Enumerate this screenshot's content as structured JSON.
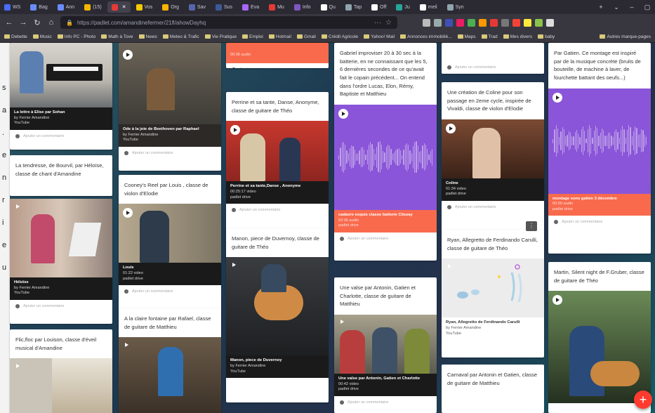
{
  "browser": {
    "tabs": [
      {
        "label": "WS",
        "color": "#4a6cf7"
      },
      {
        "label": "Bag",
        "color": "#6a8cff"
      },
      {
        "label": "Ann",
        "color": "#6a8cff"
      },
      {
        "label": "(15)",
        "color": "#f7b500"
      },
      {
        "label": "",
        "color": "#e53935",
        "active": true
      },
      {
        "label": "Vos",
        "color": "#f7c900"
      },
      {
        "label": "Org",
        "color": "#ffb300"
      },
      {
        "label": "Sav",
        "color": "#5566aa"
      },
      {
        "label": "Sus",
        "color": "#3b5998"
      },
      {
        "label": "Eva",
        "color": "#aa66ff"
      },
      {
        "label": "Mu",
        "color": "#e53935"
      },
      {
        "label": "Info",
        "color": "#7e57c2"
      },
      {
        "label": "Qu",
        "color": "#ffffff"
      },
      {
        "label": "Tap",
        "color": "#90a4ae"
      },
      {
        "label": "Off",
        "color": "#ffffff"
      },
      {
        "label": "Ju",
        "color": "#26a69a"
      },
      {
        "label": "meil",
        "color": "#ffffff"
      },
      {
        "label": "Syn",
        "color": "#90a4ae"
      }
    ],
    "url": "https://padlet.com/amandinefermer/21fl/ahowDayhq",
    "bookmarks": [
      "Debette",
      "Music",
      "Info PC - Photo",
      "Math à Tove",
      "News",
      "Meteo & Trafic",
      "Vie Pratique",
      "Emploi",
      "Hotmail",
      "Gmail",
      "Crédit Agricole",
      "Yahoo! Mail",
      "Annonces immobiliè...",
      "Maps",
      "Trad",
      "Mes divers",
      "baby",
      "Autres marque-pages"
    ]
  },
  "left_strip": [
    "s",
    "a",
    ".",
    "e",
    "n",
    "r",
    "i",
    "e",
    "u"
  ],
  "columns": [
    {
      "cards": [
        {
          "kind": "media",
          "caption_title": "La lettre à Elise par Sohan",
          "caption_sub": "by Ferrier Amandine",
          "caption_src": "YouTube",
          "bg": "#2a2a2a"
        },
        {
          "kind": "text",
          "text": "La tendresse, de Bourvil, par Héloïse, classe de chant d'Amandine"
        },
        {
          "kind": "media",
          "caption_title": "Héloïse",
          "caption_sub": "by Ferrier Amandine",
          "caption_src": "YouTube",
          "bg": "#2b2b2b"
        },
        {
          "kind": "text",
          "text": "Flic,floc par Louison, classe d'éveil musical d'Amandine"
        }
      ],
      "comment_label": "Ajouter un commentaire"
    },
    {
      "cards": [
        {
          "kind": "media",
          "caption_title": "Ode à la joie de Beethoven par Raphael",
          "caption_sub": "by Ferrier Amandine",
          "caption_src": "YouTube"
        },
        {
          "kind": "text",
          "text": "Cooney's Reel par Louis , classe de violon d'Elodie"
        },
        {
          "kind": "media",
          "caption_title": "Louis",
          "caption_sub": "01:22 video",
          "caption_src": "padlet drive"
        },
        {
          "kind": "text",
          "text": "A la claire fontaine par Rafael, classe de guitare de Matthieu"
        }
      ]
    },
    {
      "cards": [
        {
          "kind": "text",
          "text": "Perrine et sa tante, Danse, Anonyme, classe de guitare de Théo"
        },
        {
          "kind": "media",
          "caption_title": "Perrine et sa tante,Danse , Anonyme",
          "caption_sub": "00:25:17 video",
          "caption_src": "padlet drive"
        },
        {
          "kind": "text",
          "text": "Manon, piece de Duvernoy, classe de guitare de Théo"
        },
        {
          "kind": "media",
          "caption_title": "Manon, piece de Duvernoy",
          "caption_sub": "by Ferrier Amandine",
          "caption_src": "YouTube"
        }
      ],
      "top_caption": "00:36 audio"
    },
    {
      "cards": [
        {
          "kind": "text",
          "text": "Gabriel improviser 20 à 30 sec à la batterie, en ne connaissant que les 5, 6 dernières secondes de ce qu'avait fait le copain précédent... On entend dans l'ordre Lucas, Elon, Rémy, Baptiste et Matthieu"
        },
        {
          "kind": "audio",
          "caption_title": "cadavre exquis classe batterie Clissay",
          "caption_sub": "02:36 audio",
          "caption_src": "padlet drive"
        },
        {
          "kind": "text",
          "text": "Une valse par Antonin, Gatien et Charlotte, classe de guitare de Matthieu"
        },
        {
          "kind": "media",
          "caption_title": "Une valse par Antonin, Gatien et Charlotte",
          "caption_sub": "00:42 video",
          "caption_src": "padlet drive"
        }
      ]
    },
    {
      "cards": [
        {
          "kind": "text",
          "text": "Une création de Coline pour son passage en 2eme cycle, inspirée de Vivaldi, classe de violon d'Elodie"
        },
        {
          "kind": "media",
          "caption_title": "Coline",
          "caption_sub": "01:34 video",
          "caption_src": "padlet drive"
        },
        {
          "kind": "text",
          "text": "Ryan, Allegretto de Ferdinando Carulli, classe de guitare de Théo"
        },
        {
          "kind": "media",
          "caption_title": "Ryan, Allegretto de Ferdinando Carulli",
          "caption_sub": "by Ferrier Amandine",
          "caption_src": "YouTube"
        },
        {
          "kind": "text",
          "text": "Carnaval par Antonin et Gatien, classe de guitare de Matthieu"
        }
      ]
    },
    {
      "cards": [
        {
          "kind": "text",
          "text": "Par Gatien. Ce montage est inspiré par de la musique concrète (bruits de bouteille, de machine à laver, de fourchette battant des oeufs...)"
        },
        {
          "kind": "audio",
          "caption_title": "montage sons gatien 3 décembre",
          "caption_sub": "00:50 audio",
          "caption_src": "padlet drive"
        },
        {
          "kind": "text",
          "text": "Martin, Silent night de F.Gruber, classe de guitare de Théo"
        }
      ]
    }
  ],
  "fab_label": "+",
  "more_label": "⋮"
}
